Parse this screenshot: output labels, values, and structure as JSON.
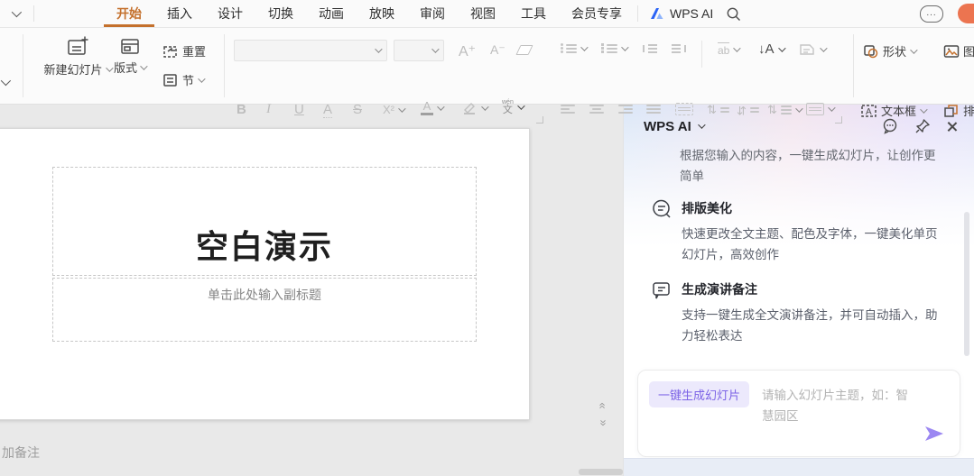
{
  "menubar": {
    "items": [
      {
        "label": "开始",
        "active": true
      },
      {
        "label": "插入",
        "active": false
      },
      {
        "label": "设计",
        "active": false
      },
      {
        "label": "切换",
        "active": false
      },
      {
        "label": "动画",
        "active": false
      },
      {
        "label": "放映",
        "active": false
      },
      {
        "label": "审阅",
        "active": false
      },
      {
        "label": "视图",
        "active": false
      },
      {
        "label": "工具",
        "active": false
      },
      {
        "label": "会员专享",
        "active": false
      }
    ],
    "wps_ai_label": "WPS AI",
    "cloud_dots": "..."
  },
  "toolbar": {
    "new_slide_label": "新建幻灯片",
    "layout_label": "版式",
    "reset_label": "重置",
    "section_label": "节",
    "shapes_label": "形状",
    "picture_label": "图",
    "textbox_label": "文本框",
    "arrange_label": "排",
    "glyphs": {
      "bold": "B",
      "italic": "I",
      "underline": "U",
      "char_frame": "A",
      "strike": "S",
      "superscript": "X²",
      "font_color": "A",
      "inc_font": "A⁺",
      "dec_font": "A⁻",
      "ab_overline": "ab",
      "vertical_text": "↓A",
      "updown": "⇅",
      "pinyin_top": "wén",
      "pinyin_char": "文",
      "nav_chevrons": "«"
    }
  },
  "slide": {
    "title": "空白演示",
    "subtitle_placeholder": "单击此处输入副标题"
  },
  "notes": {
    "placeholder": "加备注"
  },
  "ai_panel": {
    "title": "WPS AI",
    "intro": "根据您输入的内容，一键生成幻灯片，让创作更简单",
    "features": [
      {
        "title": "排版美化",
        "desc": "快速更改全文主题、配色及字体，一键美化单页幻灯片，高效创作"
      },
      {
        "title": "生成演讲备注",
        "desc": "支持一键生成全文演讲备注，并可自动插入，助力轻松表达"
      }
    ],
    "composer": {
      "chip": "一键生成幻灯片",
      "placeholder": "请输入幻灯片主题，如：智慧园区"
    }
  },
  "colors": {
    "accent_orange": "#c4702c",
    "ai_purple": "#7c63e6",
    "chip_bg": "#ece9fc",
    "send_arrow": "#9b87f2"
  }
}
